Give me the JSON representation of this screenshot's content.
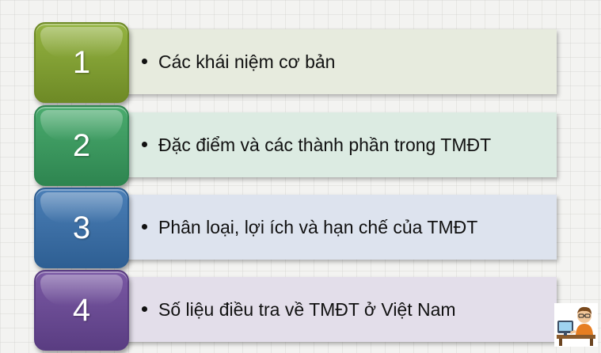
{
  "rows": [
    {
      "number": "1",
      "text": "Các khái niệm cơ bản",
      "badge_color": "#94b341",
      "badge_dark": "#6e8a26",
      "bar_color": "#e7ebde"
    },
    {
      "number": "2",
      "text": "Đặc điểm và các thành phần trong TMĐT",
      "badge_color": "#4aab6e",
      "badge_dark": "#2e8550",
      "bar_color": "#dcebe2"
    },
    {
      "number": "3",
      "text": "Phân loại, lợi ích và hạn chế của TMĐT",
      "badge_color": "#4b7fb7",
      "badge_dark": "#2e5f93",
      "bar_color": "#dde3ee"
    },
    {
      "number": "4",
      "text": "Số liệu điều tra về TMĐT ở Việt Nam",
      "badge_color": "#7a59a4",
      "badge_dark": "#5a3d82",
      "bar_color": "#e3deea"
    }
  ],
  "avatar": {
    "icon": "teacher-at-computer-icon"
  }
}
